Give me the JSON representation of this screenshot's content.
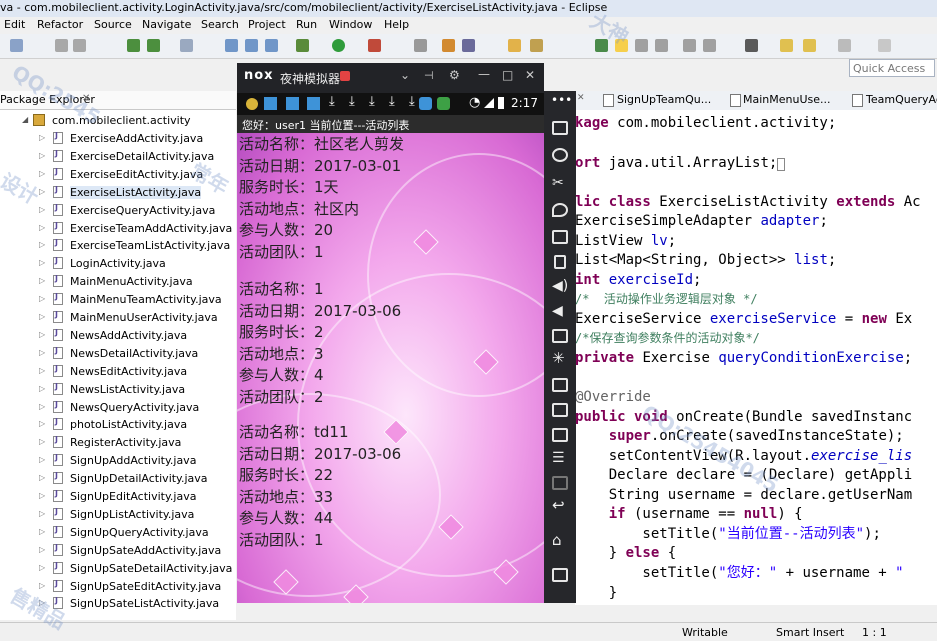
{
  "eclipse": {
    "title": "va - com.mobileclient.activity.LoginActivity.java/src/com/mobileclient/activity/ExerciseListActivity.java - Eclipse",
    "menu": [
      "Edit",
      "Refactor",
      "Source",
      "Navigate",
      "Search",
      "Project",
      "Run",
      "Window",
      "Help"
    ],
    "quick_access": "Quick Access",
    "package_explorer_title": "Package Explorer",
    "package_name": "com.mobileclient.activity",
    "files": [
      "ExerciseAddActivity.java",
      "ExerciseDetailActivity.java",
      "ExerciseEditActivity.java",
      "ExerciseListActivity.java",
      "ExerciseQueryActivity.java",
      "ExerciseTeamAddActivity.java",
      "ExerciseTeamListActivity.java",
      "LoginActivity.java",
      "MainMenuActivity.java",
      "MainMenuTeamActivity.java",
      "MainMenuUserActivity.java",
      "NewsAddActivity.java",
      "NewsDetailActivity.java",
      "NewsEditActivity.java",
      "NewsListActivity.java",
      "NewsQueryActivity.java",
      "photoListActivity.java",
      "RegisterActivity.java",
      "SignUpAddActivity.java",
      "SignUpDetailActivity.java",
      "SignUpEditActivity.java",
      "SignUpListActivity.java",
      "SignUpQueryActivity.java",
      "SignUpSateAddActivity.java",
      "SignUpSateDetailActivity.java",
      "SignUpSateEditActivity.java",
      "SignUpSateListActivity.java"
    ],
    "selected_file_index": 3,
    "editor_tabs": [
      "SignUpTeamQu...",
      "MainMenuUse...",
      "TeamQueryAc..."
    ],
    "code": [
      "kage com.mobileclient.activity;",
      "",
      "ort java.util.ArrayList;",
      "",
      "lic class ExerciseListActivity extends Ac",
      "ExerciseSimpleAdapter adapter;",
      "ListView lv;",
      "List<Map<String, Object>> list;",
      "int exerciseId;",
      "/*  活动操作业务逻辑层对象 */",
      "ExerciseService exerciseService = new Ex",
      "/*保存查询参数条件的活动对象*/",
      "private Exercise queryConditionExercise;",
      "",
      "@Override",
      "public void onCreate(Bundle savedInstanc",
      "    super.onCreate(savedInstanceState);",
      "    setContentView(R.layout.exercise_lis",
      "    Declare declare = (Declare) getAppli",
      "    String username = declare.getUserNam",
      "    if (username == null) {",
      "        setTitle(\"当前位置--活动列表\");",
      "    } else {",
      "        setTitle(\"您好：\" + username + \"",
      "    }"
    ],
    "status": [
      "Writable",
      "Smart Insert",
      "1 : 1"
    ]
  },
  "emulator": {
    "logo": "nox",
    "title": "夜神模拟器",
    "time": "2:17",
    "app_title": "您好：user1   当前位置---活动列表",
    "records": [
      [
        "活动名称：社区老人剪发",
        "活动日期：2017-03-01",
        "服务时长：1天",
        "活动地点：社区内",
        "参与人数：20",
        "活动团队：1"
      ],
      [
        "活动名称：1",
        "活动日期：2017-03-06",
        "服务时长：2",
        "活动地点：3",
        "参与人数：4",
        "活动团队：2"
      ],
      [
        "活动名称：td11",
        "活动日期：2017-03-06",
        "服务时长：22",
        "活动地点：33",
        "参与人数：44",
        "活动团队：1"
      ]
    ]
  },
  "watermarks": [
    "QQ:2545",
    "设计",
    "大神",
    "常年",
    "QQ:25454045",
    "售精品"
  ],
  "colors": {
    "keyword": "#7f0055",
    "field": "#0000c0",
    "comment": "#3f7f5f",
    "string": "#2a00ff"
  }
}
